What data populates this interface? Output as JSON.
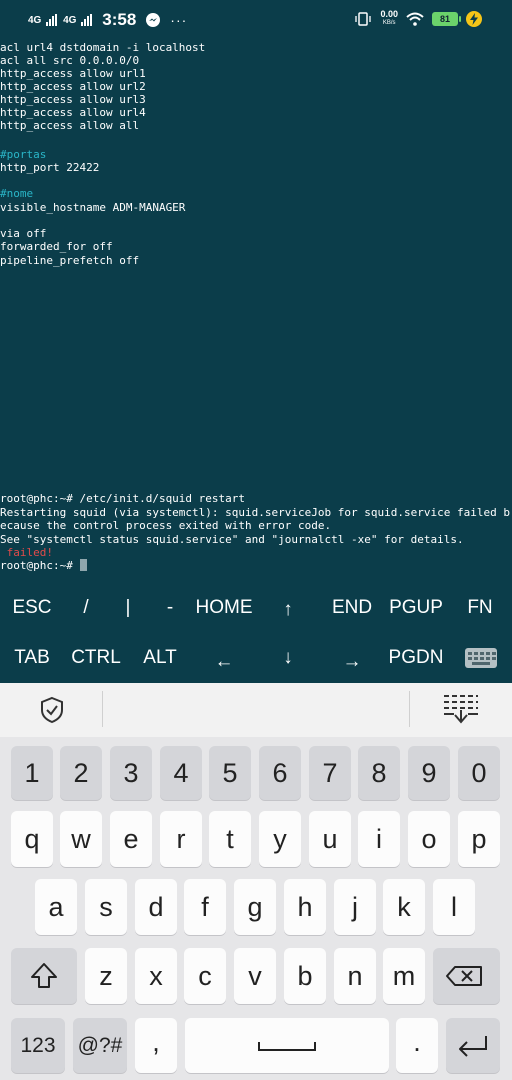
{
  "status_bar": {
    "net1": "4G",
    "net2": "4G",
    "time": "3:58",
    "more": "···",
    "speed_value": "0.00",
    "speed_unit": "KB/s",
    "battery": "81"
  },
  "terminal": {
    "lines": [
      "acl url4 dstdomain -i localhost",
      "acl all src 0.0.0.0/0",
      "http_access allow url1",
      "http_access allow url2",
      "http_access allow url3",
      "http_access allow url4",
      "http_access allow all",
      "#portas",
      "http_port 22422",
      "#nome",
      "visible_hostname ADM-MANAGER",
      "via off",
      "forwarded_for off",
      "pipeline_prefetch off",
      "root@phc:~# /etc/init.d/squid restart",
      "Restarting squid (via systemctl): squid.serviceJob for squid.service failed b",
      "ecause the control process exited with error code.",
      "See \"systemctl status squid.service\" and \"journalctl -xe\" for details.",
      " failed!",
      "root@phc:~# "
    ]
  },
  "extra_keys": {
    "row1": [
      "ESC",
      "/",
      "|",
      "-",
      "HOME",
      "↑",
      "END",
      "PGUP",
      "FN"
    ],
    "row2": [
      "TAB",
      "CTRL",
      "ALT",
      "←",
      "↓",
      "→",
      "PGDN"
    ]
  },
  "keyboard": {
    "numbers": [
      "1",
      "2",
      "3",
      "4",
      "5",
      "6",
      "7",
      "8",
      "9",
      "0"
    ],
    "row_q": [
      "q",
      "w",
      "e",
      "r",
      "t",
      "y",
      "u",
      "i",
      "o",
      "p"
    ],
    "row_a": [
      "a",
      "s",
      "d",
      "f",
      "g",
      "h",
      "j",
      "k",
      "l"
    ],
    "row_z": [
      "z",
      "x",
      "c",
      "v",
      "b",
      "n",
      "m"
    ],
    "sym_label": "123",
    "sym2_label": "@?#",
    "comma": ",",
    "period": "."
  }
}
